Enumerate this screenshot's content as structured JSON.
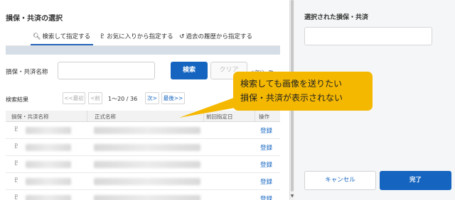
{
  "left_panel": {
    "title": "損保・共済の選択",
    "tabs": [
      {
        "icon": "search-icon",
        "label": "検索して指定する",
        "active": true
      },
      {
        "icon": "pin-icon",
        "label": "お気に入りから指定する",
        "active": false
      },
      {
        "icon": "history-icon",
        "label": "過去の履歴から指定する",
        "active": false
      }
    ],
    "search": {
      "label": "損保・共済名称",
      "value": "",
      "search_button": "検索",
      "clear_button": "クリア",
      "note": "※部分一致"
    },
    "results": {
      "label": "検索結果",
      "pager": {
        "first": "<<最初",
        "prev": "<前",
        "range": "1～20 / 36",
        "next": "次>",
        "last": "最後>>"
      },
      "columns": [
        "損保・共済名称",
        "正式名称",
        "前回指定日",
        "操作"
      ],
      "rows": [
        {
          "action": "登録"
        },
        {
          "action": "登録"
        },
        {
          "action": "登録"
        },
        {
          "action": "登録"
        },
        {
          "action": "登録"
        }
      ]
    }
  },
  "right_panel": {
    "title": "選択された損保・共済",
    "selected_value": "",
    "cancel_button": "キャンセル",
    "done_button": "完了"
  },
  "callout": {
    "line1": "検索しても画像を送りたい",
    "line2": "損保・共済が表示されない"
  },
  "colors": {
    "accent": "#1565c0",
    "callout": "#f5b800"
  }
}
